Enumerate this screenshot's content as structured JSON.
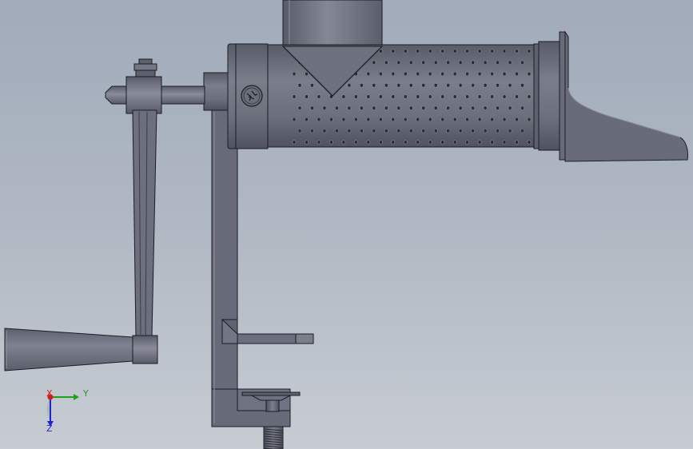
{
  "viewport": {
    "background_top": "#a1abba",
    "background_bottom": "#c7ccd3"
  },
  "model": {
    "body_color": "#676a78",
    "highlight_color": "#8d8f9c",
    "edge_color": "#1c1c24",
    "hole_rows": 9,
    "hole_columns": 20
  },
  "triad": {
    "x_label": "X",
    "y_label": "Y",
    "z_label": "Z",
    "x_color": "#d21e1e",
    "y_color": "#1ea01e",
    "z_color": "#1e28c8"
  }
}
